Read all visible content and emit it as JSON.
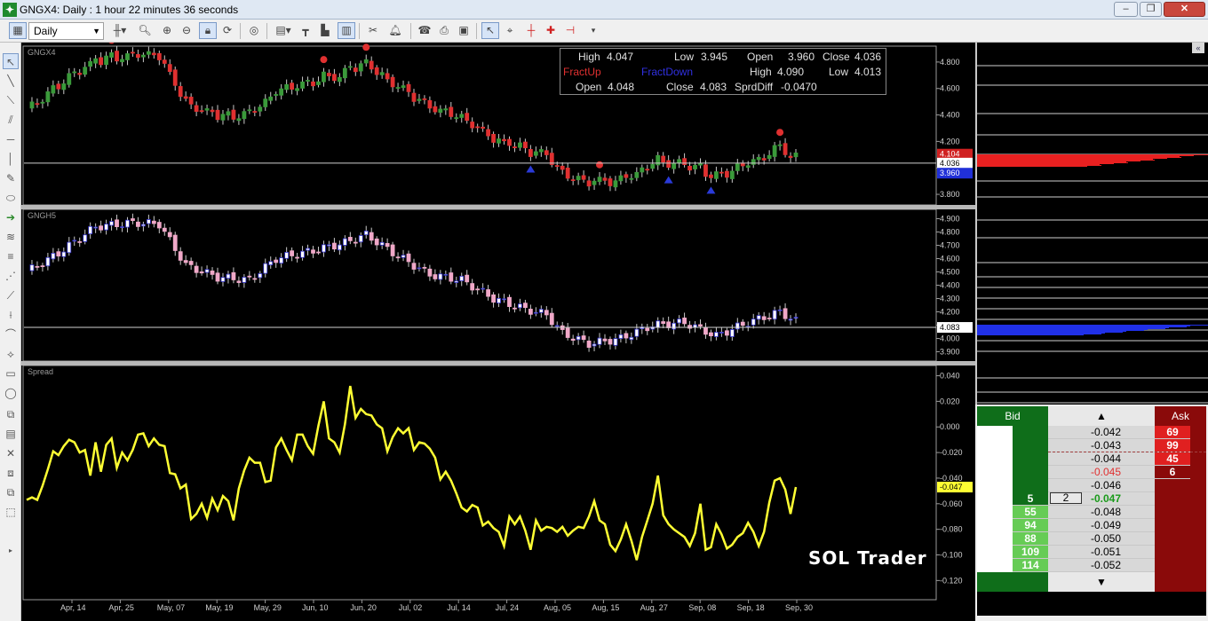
{
  "window": {
    "title": "GNGX4: Daily : 1 hour 22 minutes 36 seconds",
    "app_icon": "chart-app-icon",
    "controls": {
      "minimize": "‒",
      "maximize": "❐",
      "close": "✕"
    }
  },
  "toolbar": {
    "period": "Daily",
    "buttons": [
      "new-chart-icon",
      "bar-type-icon",
      "zoom-in-icon",
      "zoom-out-icon",
      "lock-icon",
      "refresh-icon",
      "template-icon",
      "indicator-icon",
      "draw-tools-icon",
      "bar-chart-icon",
      "color-icon",
      "scissors-icon",
      "bell-icon",
      "phone-icon",
      "print-icon",
      "cursor-icon",
      "crosshair-icon",
      "cross-icon",
      "plus-icon",
      "marker-icon"
    ]
  },
  "info_box": {
    "row1": {
      "high_label": "High",
      "high": "4.047",
      "low_label": "Low",
      "low": "3.945",
      "open_label": "Open",
      "open": "3.960",
      "close_label": "Close",
      "close": "4.036"
    },
    "row2": {
      "fract_up": "FractUp",
      "fract_down": "FractDown",
      "high_label": "High",
      "high": "4.090",
      "low_label": "Low",
      "low": "4.013"
    },
    "row3": {
      "open_label": "Open",
      "open": "4.048",
      "close_label": "Close",
      "close": "4.083",
      "spread_label": "SprdDiff",
      "spread": "-0.0470"
    },
    "colors": {
      "fract_up": "#e03030",
      "fract_down": "#3030e0"
    }
  },
  "panels": [
    {
      "name": "GNGX4",
      "ticks": [
        "4.800",
        "4.600",
        "4.400",
        "4.200",
        "4.000",
        "3.800"
      ],
      "price_label": "4.036",
      "high_label": "4.104",
      "low_label": "3.960",
      "color_up": "#3a9a3a",
      "color_down": "#e03030"
    },
    {
      "name": "GNGH5",
      "ticks": [
        "4.900",
        "4.800",
        "4.700",
        "4.600",
        "4.500",
        "4.400",
        "4.300",
        "4.200",
        "4.100",
        "4.000",
        "3.900"
      ],
      "price_label": "4.083",
      "color_up": "#3030c8",
      "color_down": "#f0a8c8"
    },
    {
      "name": "Spread",
      "ticks": [
        "0.040",
        "0.020",
        "0.000",
        "-0.020",
        "-0.040",
        "-0.060",
        "-0.080",
        "-0.100",
        "-0.120"
      ],
      "price_label": "-0.047",
      "color": "#ffff33"
    }
  ],
  "x_axis": [
    "Apr, 14",
    "Apr, 25",
    "May, 07",
    "May, 19",
    "May, 29",
    "Jun, 10",
    "Jun, 20",
    "Jul, 02",
    "Jul, 14",
    "Jul, 24",
    "Aug, 05",
    "Aug, 15",
    "Aug, 27",
    "Sep, 08",
    "Sep, 18",
    "Sep, 30"
  ],
  "watermark": "SOL Trader",
  "ladder": {
    "bid_header": "Bid",
    "ask_header": "Ask",
    "up_arrow": "▲",
    "down_arrow": "▼",
    "quantity_input": "2",
    "rows": [
      {
        "price": "-0.042",
        "bid": "",
        "ask": "69"
      },
      {
        "price": "-0.043",
        "bid": "",
        "ask": "99"
      },
      {
        "price": "-0.044",
        "bid": "",
        "ask": "45"
      },
      {
        "price": "-0.045",
        "bid": "",
        "ask": "6"
      },
      {
        "price": "-0.046",
        "bid": "",
        "ask": ""
      },
      {
        "price": "-0.047",
        "bid": "5",
        "ask": ""
      },
      {
        "price": "-0.048",
        "bid": "55",
        "ask": ""
      },
      {
        "price": "-0.049",
        "bid": "94",
        "ask": ""
      },
      {
        "price": "-0.050",
        "bid": "88",
        "ask": ""
      },
      {
        "price": "-0.051",
        "bid": "109",
        "ask": ""
      },
      {
        "price": "-0.052",
        "bid": "114",
        "ask": ""
      }
    ],
    "colors": {
      "bid_dark": "#0f6e1a",
      "bid_light": "#66cc55",
      "ask_dark": "#8a0a0a",
      "ask_light": "#e02020",
      "last": "#1a9a1a",
      "sell_price": "#e03030"
    }
  },
  "spread_series": [
    -0.057,
    -0.055,
    -0.057,
    -0.046,
    -0.033,
    -0.019,
    -0.022,
    -0.015,
    -0.01,
    -0.012,
    -0.02,
    -0.018,
    -0.038,
    -0.012,
    -0.035,
    -0.014,
    -0.009,
    -0.032,
    -0.02,
    -0.026,
    -0.018,
    -0.006,
    -0.005,
    -0.015,
    -0.009,
    -0.014,
    -0.015,
    -0.036,
    -0.037,
    -0.048,
    -0.045,
    -0.072,
    -0.068,
    -0.06,
    -0.071,
    -0.056,
    -0.065,
    -0.054,
    -0.058,
    -0.073,
    -0.048,
    -0.034,
    -0.024,
    -0.028,
    -0.028,
    -0.043,
    -0.042,
    -0.016,
    -0.009,
    -0.018,
    -0.026,
    -0.006,
    -0.006,
    -0.015,
    -0.021,
    0.001,
    0.02,
    -0.009,
    -0.012,
    -0.02,
    0.002,
    0.032,
    0.007,
    0.014,
    0.01,
    0.009,
    0.002,
    -0.001,
    -0.019,
    -0.008,
    -0.001,
    -0.005,
    -0.001,
    -0.018,
    -0.012,
    -0.013,
    -0.017,
    -0.024,
    -0.041,
    -0.035,
    -0.042,
    -0.052,
    -0.063,
    -0.066,
    -0.061,
    -0.063,
    -0.077,
    -0.074,
    -0.079,
    -0.082,
    -0.093,
    -0.07,
    -0.076,
    -0.07,
    -0.081,
    -0.096,
    -0.073,
    -0.081,
    -0.078,
    -0.079,
    -0.082,
    -0.078,
    -0.085,
    -0.081,
    -0.078,
    -0.079,
    -0.07,
    -0.058,
    -0.073,
    -0.076,
    -0.092,
    -0.097,
    -0.088,
    -0.076,
    -0.089,
    -0.104,
    -0.086,
    -0.073,
    -0.06,
    -0.038,
    -0.069,
    -0.076,
    -0.08,
    -0.083,
    -0.086,
    -0.093,
    -0.083,
    -0.06,
    -0.096,
    -0.094,
    -0.076,
    -0.084,
    -0.095,
    -0.092,
    -0.086,
    -0.083,
    -0.075,
    -0.082,
    -0.093,
    -0.082,
    -0.059,
    -0.042,
    -0.04,
    -0.049,
    -0.068,
    -0.047
  ]
}
